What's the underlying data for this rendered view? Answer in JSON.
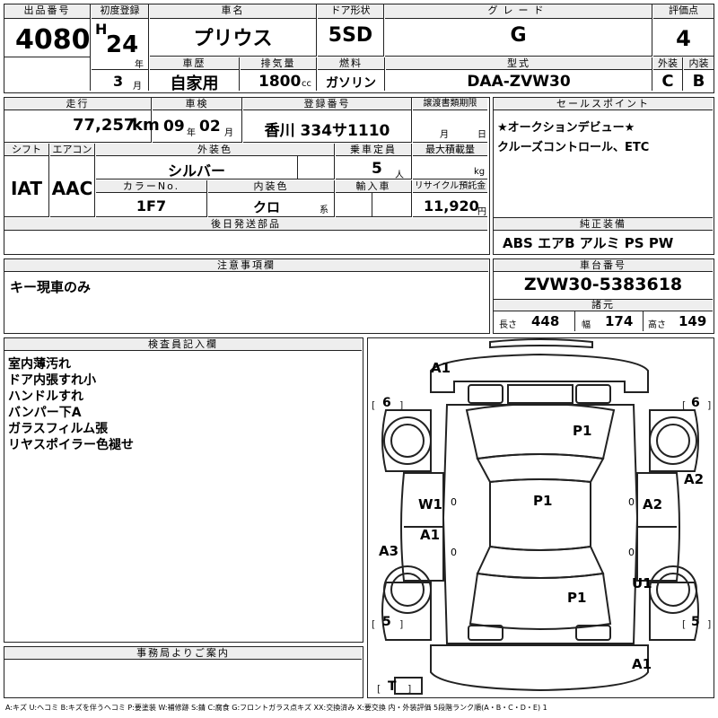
{
  "labels": {
    "lot_no": "出品番号",
    "first_reg": "初度登録",
    "car_name": "車名",
    "door_type": "ドア形状",
    "grade": "グレード",
    "score": "評価点",
    "history": "車歴",
    "displacement": "排気量",
    "fuel": "燃料",
    "model": "型式",
    "exterior": "外装",
    "interior": "内装",
    "year_suffix": "年",
    "month_suffix": "月",
    "cc": "cc",
    "mileage": "走行",
    "inspection": "車検",
    "reg_no": "登録番号",
    "transfer": "譲渡書類期限",
    "sales_point": "セールスポイント",
    "shift": "シフト",
    "aircon": "エアコン",
    "ext_color": "外装色",
    "capacity": "乗車定員",
    "max_load": "最大積載量",
    "color_no": "カラーNo.",
    "int_color": "内装色",
    "import": "輸入車",
    "recycle": "リサイクル預託金",
    "later_parts": "後日発送部品",
    "genuine_equip": "純正装備",
    "notes": "注意事項欄",
    "chassis_no": "車台番号",
    "dimensions": "諸元",
    "length": "長さ",
    "width": "幅",
    "height": "高さ",
    "inspector": "検査員記入欄",
    "office_info": "事務局よりご案内",
    "km": "km",
    "people": "人",
    "kg": "kg",
    "yen": "円",
    "kei": "系",
    "ins_year": "年",
    "ins_month": "月",
    "tr_month": "月",
    "tr_day": "日"
  },
  "values": {
    "lot_no": "4080",
    "era": "H",
    "year": "24",
    "month": "3",
    "car_name": "プリウス",
    "door_type": "5SD",
    "grade": "G",
    "score": "4",
    "history": "自家用",
    "displacement": "1800",
    "fuel": "ガソリン",
    "model": "DAA-ZVW30",
    "exterior_grade": "C",
    "interior_grade": "B",
    "mileage": "77,257",
    "inspection_year": "09",
    "inspection_month": "02",
    "reg_no": "香川 334サ1110",
    "sales_point_lines": [
      "★オークションデビュー★",
      "クルーズコントロール、ETC"
    ],
    "shift": "IAT",
    "aircon": "AAC",
    "ext_color": "シルバー",
    "capacity": "5",
    "color_no": "1F7",
    "int_color": "クロ",
    "recycle": "11,920",
    "genuine_equip": "ABS エアB アルミ PS PW",
    "notes": "キー現車のみ",
    "chassis_no": "ZVW30-5383618",
    "length": "448",
    "width": "174",
    "height": "149",
    "inspector_lines": [
      "室内薄汚れ",
      "ドア内張すれ小",
      "ハンドルすれ",
      "バンパー下A",
      "ガラスフィルム張",
      "リヤスポイラー色褪せ"
    ]
  },
  "diagram": {
    "marks": [
      "A1",
      "P1",
      "W1",
      "P1",
      "A2",
      "A2",
      "A1",
      "A3",
      "U1",
      "P1",
      "A1"
    ],
    "zeros": [
      "0",
      "0",
      "0",
      "0"
    ],
    "tires": [
      "6",
      "6",
      "5",
      "5",
      "T"
    ]
  },
  "legend": "A:キズ U:ヘコミ B:キズを伴うヘコミ P:要塗装 W:補修跡 S:錆 C:腐食 G:フロントガラス点キズ XX:交換済み X:要交換 内・外装評価 5段階ランク順(A・B・C・D・E) 1"
}
